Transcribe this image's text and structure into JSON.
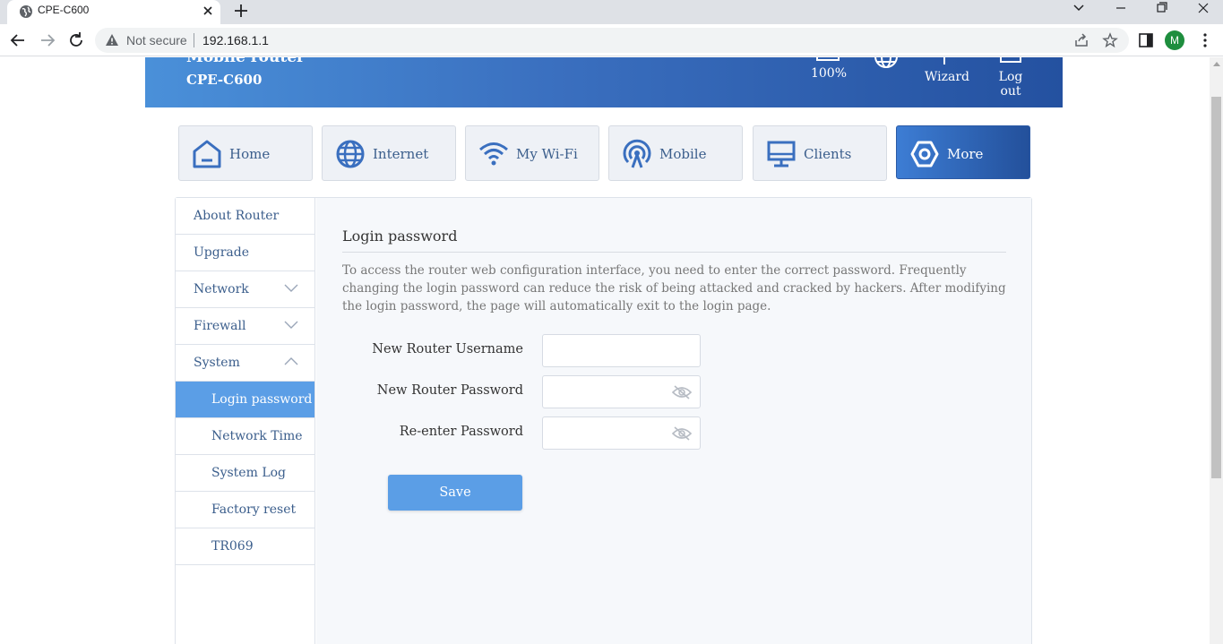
{
  "browser": {
    "tab_title": "CPE-C600",
    "security_label": "Not secure",
    "url": "192.168.1.1",
    "profile_initial": "M"
  },
  "header": {
    "brand_line1": "Mobile router",
    "brand_line2": "CPE-C600",
    "battery_label": "100%",
    "wizard_label": "Wizard",
    "logout_label": "Log out"
  },
  "nav": {
    "tiles": [
      {
        "label": "Home",
        "icon": "home-icon",
        "active": false
      },
      {
        "label": "Internet",
        "icon": "globe-icon",
        "active": false
      },
      {
        "label": "My Wi-Fi",
        "icon": "wifi-icon",
        "active": false
      },
      {
        "label": "Mobile",
        "icon": "signal-tower-icon",
        "active": false
      },
      {
        "label": "Clients",
        "icon": "monitor-icon",
        "active": false
      },
      {
        "label": "More",
        "icon": "hexagon-icon",
        "active": true
      }
    ]
  },
  "sidebar": {
    "items": [
      {
        "label": "About Router"
      },
      {
        "label": "Upgrade"
      },
      {
        "label": "Network",
        "chevron": "down"
      },
      {
        "label": "Firewall",
        "chevron": "down"
      },
      {
        "label": "System",
        "chevron": "up"
      },
      {
        "label": "Login password",
        "sub": true,
        "selected": true
      },
      {
        "label": "Network Time",
        "sub": true
      },
      {
        "label": "System Log",
        "sub": true
      },
      {
        "label": "Factory reset",
        "sub": true
      },
      {
        "label": "TR069",
        "sub": true
      }
    ]
  },
  "main": {
    "title": "Login password",
    "description": "To access the router web configuration interface, you need to enter the correct password. Frequently changing the login password can reduce the risk of being attacked and cracked by hackers. After modifying the login password, the page will automatically exit to the login page.",
    "fields": {
      "username_label": "New Router Username",
      "username_value": "",
      "password_label": "New Router Password",
      "password_value": "",
      "reenter_label": "Re-enter Password",
      "reenter_value": ""
    },
    "save_label": "Save"
  },
  "colors": {
    "accent": "#5b9ee6",
    "banner_start": "#4a90d9",
    "banner_end": "#2451a0",
    "nav_text": "#3b5e8c"
  }
}
